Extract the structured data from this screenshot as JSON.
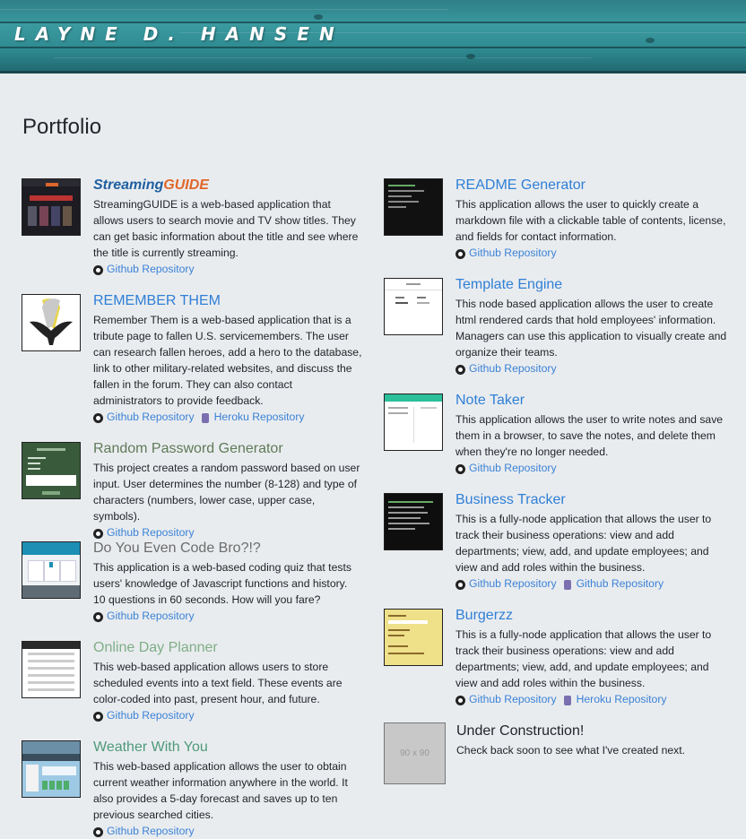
{
  "header": {
    "brand": "LAYNE D. HANSEN"
  },
  "page": {
    "title": "Portfolio"
  },
  "projects_left": [
    {
      "title_a": "Streaming",
      "title_b": "GUIDE",
      "title_color": "#1f5fa0",
      "title_color_b": "#e0662a",
      "description": "StreamingGUIDE is a web-based application that allows users to search movie and TV show titles. They can get basic information about the title and see where the title is currently streaming.",
      "link1": "Github Repository"
    },
    {
      "title": "REMEMBER THEM",
      "title_color": "#2f7fd6",
      "description": "Remember Them is a web-based application that is a tribute page to fallen U.S. servicemembers. The user can research fallen heroes, add a hero to the database, link to other military-related websites, and discuss the fallen in the forum. They can also contact administrators to provide feedback.",
      "link1": "Github Repository",
      "link2": "Heroku Repository"
    },
    {
      "title": "Random Password Generator",
      "title_color": "#5f7a57",
      "description": "This project creates a random password based on user input. User determines the number (8-128) and type of characters (numbers, lower case, upper case, symbols).",
      "link1": "Github Repository"
    },
    {
      "title": "Do You Even Code Bro?!?",
      "title_color": "#6c6c6c",
      "description": "This application is a web-based coding quiz that tests users' knowledge of Javascript functions and history. 10 questions in 60 seconds. How will you fare?",
      "link1": "Github Repository"
    },
    {
      "title": "Online Day Planner",
      "title_color": "#7fae86",
      "description": "This web-based application allows users to store scheduled events into a text field. These events are color-coded into past, present hour, and future.",
      "link1": "Github Repository"
    },
    {
      "title": "Weather With You",
      "title_color": "#4e9a7a",
      "description": "This web-based application allows the user to obtain current weather information anywhere in the world. It also provides a 5-day forecast and saves up to ten previous searched cities.",
      "link1": "Github Repository"
    }
  ],
  "projects_right": [
    {
      "title": "README Generator",
      "title_color": "#2f7fd6",
      "description": "This application allows the user to quickly create a markdown file with a clickable table of contents, license, and fields for contact information.",
      "link1": "Github Repository"
    },
    {
      "title": "Template Engine",
      "title_color": "#2f7fd6",
      "description": "This node based application allows the user to create html rendered cards that hold employees' information. Managers can use this application to visually create and organize their teams.",
      "link1": "Github Repository"
    },
    {
      "title": "Note Taker",
      "title_color": "#2f7fd6",
      "description": "This application allows the user to write notes and save them in a browser, to save the notes, and delete them when they're no longer needed.",
      "link1": "Github Repository"
    },
    {
      "title": "Business Tracker",
      "title_color": "#2f7fd6",
      "description": "This is a fully-node application that allows the user to track their business operations: view and add departments; view, add, and update employees; and view and add roles within the business.",
      "link1": "Github Repository",
      "link2": "Github Repository"
    },
    {
      "title": "Burgerzz",
      "title_color": "#2f7fd6",
      "description": "This is a fully-node application that allows the user to track their business operations: view and add departments; view, add, and update employees; and view and add roles within the business.",
      "link1": "Github Repository",
      "link2": "Heroku Repository"
    }
  ],
  "under_construction": {
    "placeholder": "90 x 90",
    "title": "Under Construction!",
    "description": "Check back soon to see what I've created next."
  }
}
